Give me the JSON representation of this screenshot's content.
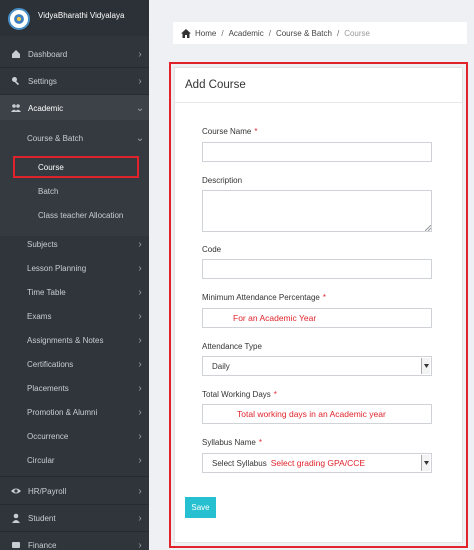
{
  "brand": {
    "name": "VidyaBharathi Vidyalaya"
  },
  "sidebar": {
    "items": [
      {
        "label": "Dashboard",
        "icon": "dashboard-icon"
      },
      {
        "label": "Settings",
        "icon": "settings-icon"
      },
      {
        "label": "Academic",
        "icon": "users-icon"
      }
    ],
    "academic_sub": [
      {
        "label": "Course & Batch"
      },
      {
        "label": "Course"
      },
      {
        "label": "Batch"
      },
      {
        "label": "Class teacher Allocation"
      },
      {
        "label": "Subjects"
      },
      {
        "label": "Lesson Planning"
      },
      {
        "label": "Time Table"
      },
      {
        "label": "Exams"
      },
      {
        "label": "Assignments & Notes"
      },
      {
        "label": "Certifications"
      },
      {
        "label": "Placements"
      },
      {
        "label": "Promotion & Alumni"
      },
      {
        "label": "Occurrence"
      },
      {
        "label": "Circular"
      }
    ],
    "bottom_items": [
      {
        "label": "HR/Payroll",
        "icon": "eye-icon"
      },
      {
        "label": "Student",
        "icon": "user-icon"
      },
      {
        "label": "Finance",
        "icon": "finance-icon"
      }
    ]
  },
  "breadcrumb": {
    "items": [
      "Home",
      "Academic",
      "Course & Batch"
    ],
    "current": "Course"
  },
  "form": {
    "title": "Add Course",
    "course_name": {
      "label": "Course Name",
      "value": ""
    },
    "description": {
      "label": "Description",
      "value": ""
    },
    "code": {
      "label": "Code",
      "value": ""
    },
    "min_attendance": {
      "label": "Minimum Attendance Percentage",
      "value": "For an Academic Year"
    },
    "attendance_type": {
      "label": "Attendance Type",
      "selected": "Daily"
    },
    "working_days": {
      "label": "Total Working Days",
      "value": "Total working days in an Academic year"
    },
    "syllabus": {
      "label": "Syllabus Name",
      "selected": "Select Syllabus",
      "hint": "Select grading GPA/CCE"
    },
    "required_mark": "*",
    "save_label": "Save"
  },
  "colors": {
    "accent": "#26c0d0",
    "annotation_red": "#e0232b",
    "sidebar_bg": "#2f353b"
  }
}
